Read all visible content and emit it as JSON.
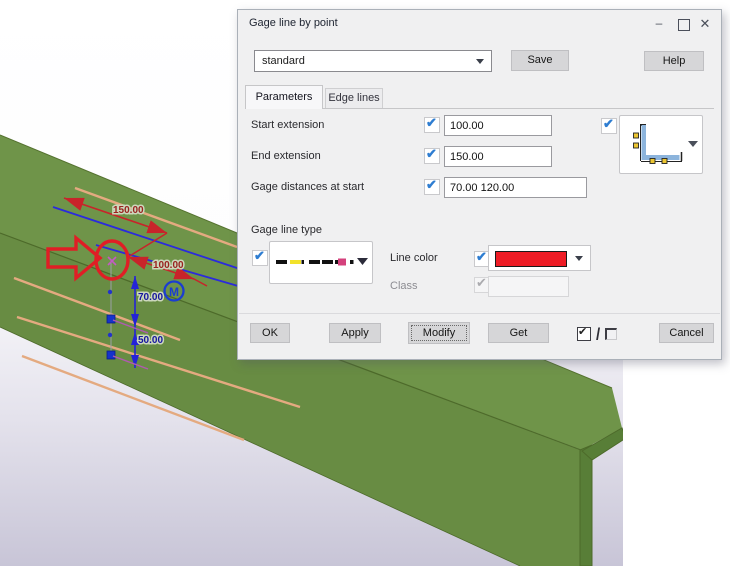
{
  "scene": {
    "red_dims": [
      "150.00",
      "100.00"
    ],
    "blue_dims": [
      "70.00",
      "50.00"
    ],
    "origin_symbol_letter": "M",
    "colors": {
      "beam_top": "#6f9449",
      "beam_front": "#688c43",
      "beam_end": "#587e37",
      "gage_line_tan": "#e4aa80",
      "dimension_red": "#c8242a",
      "annotation_red": "#e01e25",
      "dimension_blue": "#2424d6",
      "handle_blue": "#1533cc",
      "marker_magenta": "#c45ac4"
    }
  },
  "dialog": {
    "title": "Gage line by point",
    "window": {
      "minimize": "–",
      "close": "✕"
    },
    "profile_combo": {
      "value": "standard"
    },
    "save_label": "Save",
    "help_label": "Help",
    "tabs": [
      {
        "label": "Parameters",
        "active": true
      },
      {
        "label": "Edge lines",
        "active": false
      }
    ],
    "fields": {
      "start_extension": {
        "label": "Start extension",
        "value": "100.00",
        "checked": true
      },
      "end_extension": {
        "label": "End extension",
        "value": "150.00",
        "checked": true
      },
      "gage_distances": {
        "label": "Gage distances at start",
        "value": "70.00 120.00",
        "checked": true
      }
    },
    "profile_picker": {
      "checked": true,
      "icon": "l-profile-gage-points-icon"
    },
    "gage_line_type": {
      "label": "Gage line type",
      "checked": true,
      "pattern": "dash-black-yellow-black-black-magenta-dot"
    },
    "line_color": {
      "label": "Line color",
      "checked": true,
      "color": "#ee1c25"
    },
    "class_field": {
      "label": "Class",
      "checked": true,
      "enabled": false,
      "value": ""
    },
    "buttons": {
      "ok": "OK",
      "apply": "Apply",
      "modify": "Modify",
      "get": "Get",
      "cancel": "Cancel"
    },
    "toggle_separator": "/"
  }
}
